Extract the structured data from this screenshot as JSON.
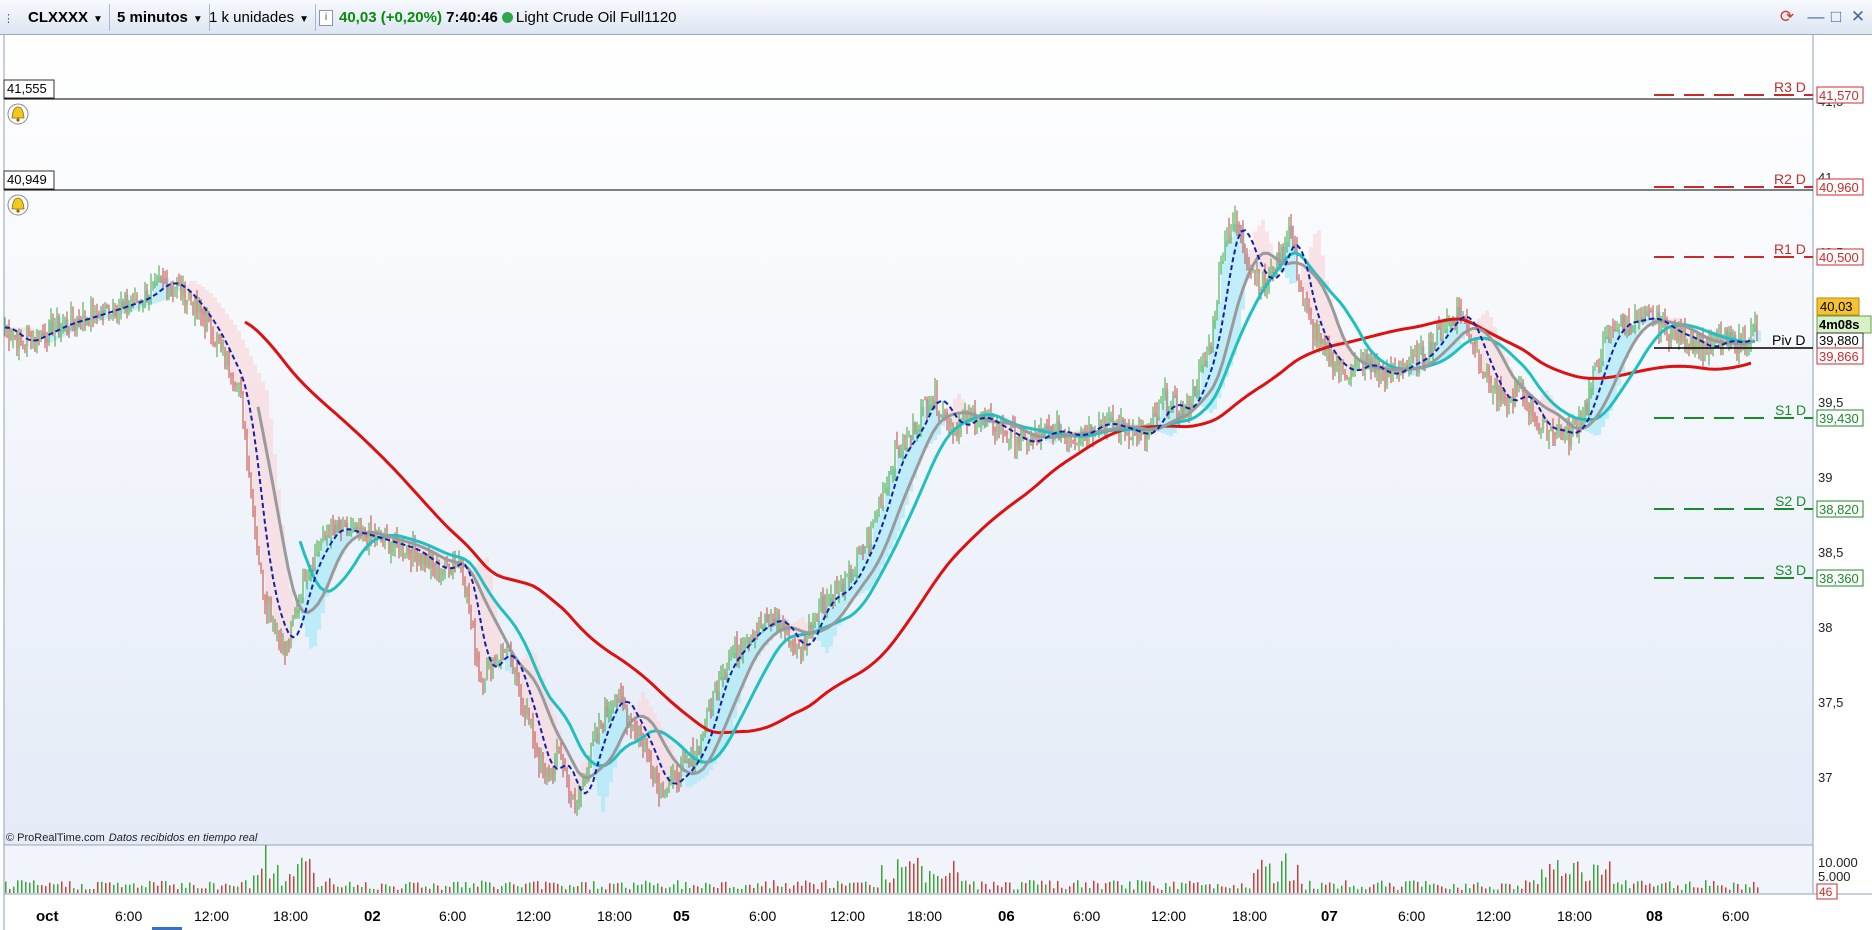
{
  "toolbar": {
    "instrument": "CLXXXX",
    "timeframe": "5 minutos",
    "units": "1 k unidades",
    "info_icon": "info-icon",
    "price_change": "40,03 (+0,20%)",
    "clock": "7:40:46",
    "status_color": "#2ea84a",
    "instrument_name": "Light Crude Oil Full1120"
  },
  "window": {
    "refresh_icon": "refresh-icon",
    "minimize": "—",
    "maximize": "□",
    "close": "✕"
  },
  "alerts": [
    {
      "value": "41,555",
      "icon": "bell-icon"
    },
    {
      "value": "40,949",
      "icon": "bell-icon"
    }
  ],
  "pivots": [
    {
      "name": "R3 D",
      "value": "41,570",
      "color": "#cc2a2a"
    },
    {
      "name": "R2 D",
      "value": "40,960",
      "color": "#cc2a2a"
    },
    {
      "name": "R1 D",
      "value": "40,500",
      "color": "#cc2a2a"
    },
    {
      "name": "Piv D",
      "value": "39,880",
      "color": "#000000"
    },
    {
      "name": "S1 D",
      "value": "39,430",
      "color": "#1a8a2a"
    },
    {
      "name": "S2 D",
      "value": "38,820",
      "color": "#1a8a2a"
    },
    {
      "name": "S3 D",
      "value": "38,360",
      "color": "#1a8a2a"
    }
  ],
  "price_axis": {
    "ticks": [
      "41,5",
      "41",
      "40,5",
      "40",
      "39,5",
      "39",
      "38,5",
      "38",
      "37,5",
      "37"
    ],
    "last_price": "40,03",
    "countdown": "4m08s",
    "ma_value": "39,866"
  },
  "volume_axis": {
    "ticks": [
      "10.000",
      "5.000"
    ],
    "last_volume": "46"
  },
  "time_axis": [
    "oct",
    "6:00",
    "12:00",
    "18:00",
    "02",
    "6:00",
    "12:00",
    "18:00",
    "05",
    "6:00",
    "12:00",
    "18:00",
    "06",
    "6:00",
    "12:00",
    "18:00",
    "07",
    "6:00",
    "12:00",
    "18:00",
    "08",
    "6:00"
  ],
  "credit": {
    "source": "© ProRealTime.com",
    "note": "Datos recibidos en tiempo real"
  },
  "colors": {
    "background_top": "#ffffff",
    "background_bottom": "#e4ebf7",
    "candle_up": "#3aa53a",
    "candle_down": "#c2453c",
    "ma_slow": "#dd1111",
    "ma_fast": "#20c0c0",
    "ma_gray": "#9a9a9a",
    "ma_dashed": "#1122aa",
    "cloud": "#a8eaf8"
  }
}
